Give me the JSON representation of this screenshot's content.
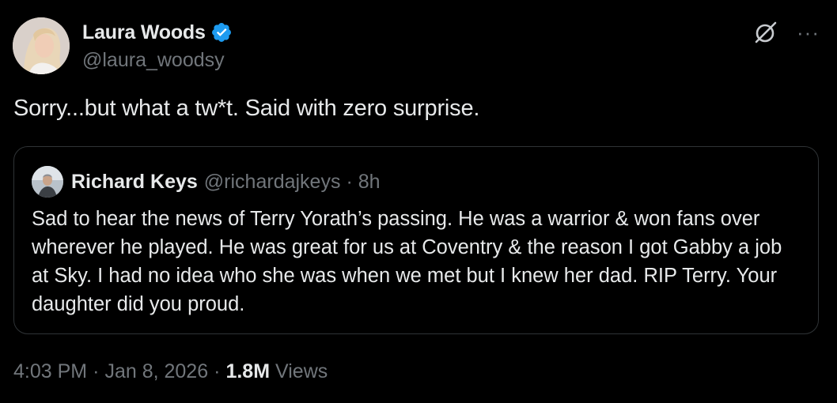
{
  "author": {
    "display_name": "Laura Woods",
    "handle": "@laura_woodsy",
    "verified_icon": "verified-badge-icon",
    "verified_color": "#1d9bf0"
  },
  "actions": {
    "grok_icon": "grok-icon",
    "more_label": "···"
  },
  "tweet": {
    "text": "Sorry...but what a tw*t. Said with zero surprise."
  },
  "quoted_tweet": {
    "display_name": "Richard Keys",
    "handle": "@richardajkeys",
    "separator": "·",
    "time": "8h",
    "text": "Sad to hear the news of Terry Yorath’s passing. He was a warrior & won fans over wherever he played. He was great for us at Coventry & the reason I got Gabby a job at Sky. I had no idea who she was when we met but I knew her dad. RIP Terry. Your daughter did you proud."
  },
  "meta": {
    "time": "4:03 PM",
    "separator": "·",
    "date": "Jan 8, 2026",
    "views_count": "1.8M",
    "views_label": "Views"
  },
  "colors": {
    "background": "#000000",
    "primary_text": "#e7e9ea",
    "secondary_text": "#71767b",
    "border": "#2f3336"
  }
}
